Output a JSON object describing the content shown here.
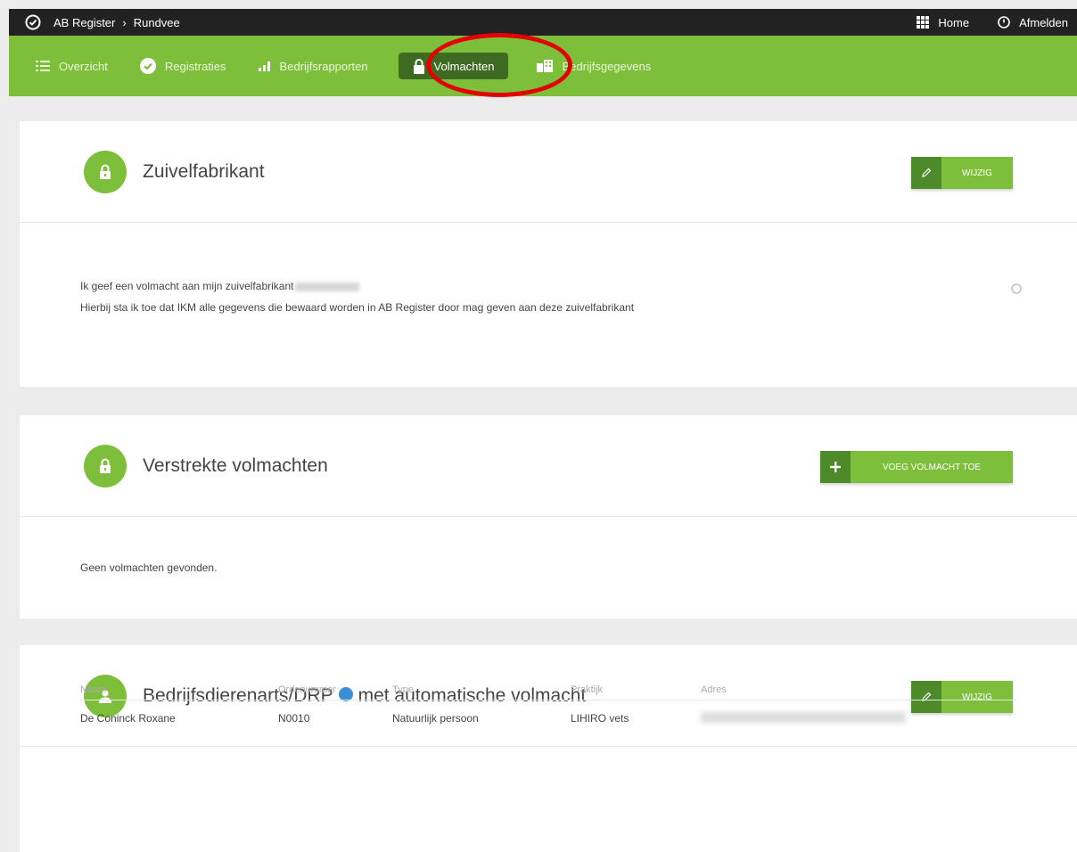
{
  "topbar": {
    "breadcrumb": [
      "AB Register",
      "Rundvee"
    ],
    "separator": "›",
    "home_label": "Home",
    "logout_label": "Afmelden"
  },
  "nav": {
    "items": [
      {
        "label": "Overzicht",
        "icon": "list-icon"
      },
      {
        "label": "Registraties",
        "icon": "check-circle-icon"
      },
      {
        "label": "Bedrijfsrapporten",
        "icon": "bar-chart-icon"
      },
      {
        "label": "Volmachten",
        "icon": "lock-icon",
        "active": true
      },
      {
        "label": "Bedrijfsgegevens",
        "icon": "building-icon"
      }
    ]
  },
  "zuivel": {
    "title": "Zuivelfabrikant",
    "edit_label": "WIJZIG",
    "line1": "Ik geef een volmacht aan mijn zuivelfabrikant",
    "line2": "Hierbij sta ik toe dat IKM alle gegevens die bewaard worden in AB Register door mag geven aan deze zuivelfabrikant"
  },
  "verstrekte": {
    "title": "Verstrekte volmachten",
    "add_label": "VOEG VOLMACHT TOE",
    "empty_message": "Geen volmachten gevonden."
  },
  "dierenarts": {
    "title_part1": "Bedrijfsdierenarts/DRP",
    "title_part2": "met automatische volmacht",
    "edit_label": "WIJZIG",
    "columns": [
      "Naam",
      "Ordenummer",
      "Type",
      "Praktijk",
      "Adres"
    ],
    "rows": [
      {
        "naam": "De Coninck Roxane",
        "ordenummer": "N0010",
        "type": "Natuurlijk persoon",
        "praktijk": "LIHIRO vets"
      }
    ]
  },
  "colors": {
    "brand_green": "#7dbf3b",
    "dark_green": "#3f6a22",
    "highlight": "#e50000",
    "info_blue": "#3b8fd6"
  }
}
